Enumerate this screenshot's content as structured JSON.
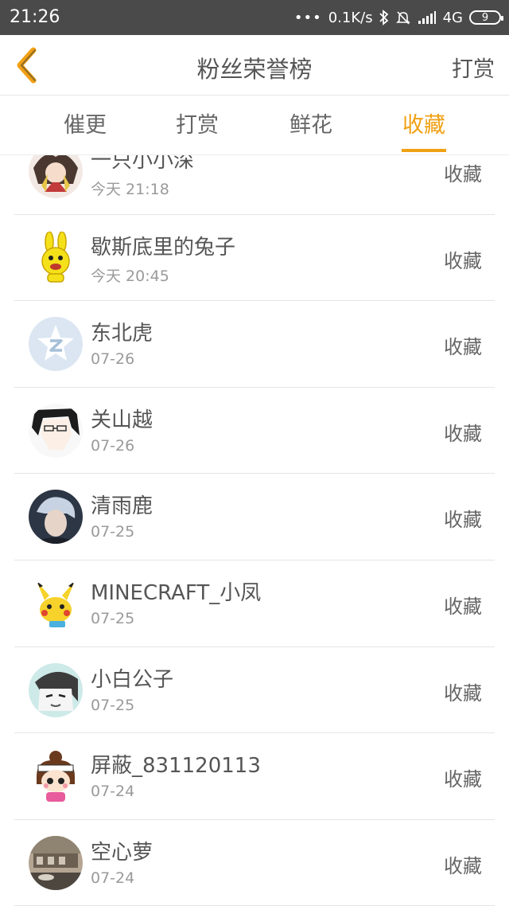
{
  "status_bar": {
    "time": "21:26",
    "network_speed": "0.1K/s",
    "network_type": "4G",
    "battery": "9"
  },
  "nav": {
    "title": "粉丝荣誉榜",
    "action": "打赏"
  },
  "tabs": [
    {
      "label": "催更",
      "active": false
    },
    {
      "label": "打赏",
      "active": false
    },
    {
      "label": "鲜花",
      "active": false
    },
    {
      "label": "收藏",
      "active": true
    }
  ],
  "fans": [
    {
      "name": "一只小小深",
      "date": "今天 21:18",
      "action": "收藏"
    },
    {
      "name": "歇斯底里的兔子",
      "date": "今天 20:45",
      "action": "收藏"
    },
    {
      "name": "东北虎",
      "date": "07-26",
      "action": "收藏"
    },
    {
      "name": "关山越",
      "date": "07-26",
      "action": "收藏"
    },
    {
      "name": "清雨鹿",
      "date": "07-25",
      "action": "收藏"
    },
    {
      "name": "MINECRAFT_小凤",
      "date": "07-25",
      "action": "收藏"
    },
    {
      "name": "小白公子",
      "date": "07-25",
      "action": "收藏"
    },
    {
      "name": "屏蔽_831120113",
      "date": "07-24",
      "action": "收藏"
    },
    {
      "name": "空心萝",
      "date": "07-24",
      "action": "收藏"
    }
  ],
  "colors": {
    "accent": "#f0a013",
    "status_bar": "#4a4a4a"
  }
}
